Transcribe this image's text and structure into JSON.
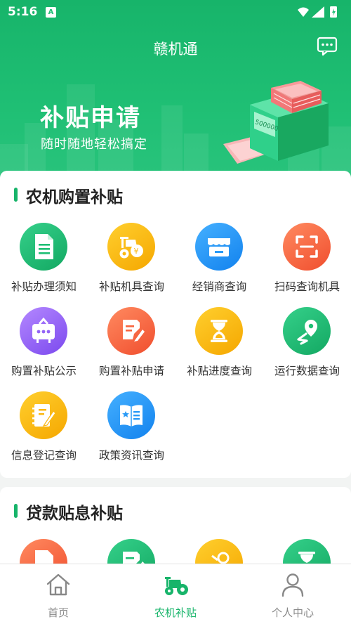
{
  "status_bar": {
    "time": "5:16",
    "indicator": "A"
  },
  "header": {
    "title": "赣机通",
    "message_icon": "chat-bubble-icon"
  },
  "banner": {
    "title": "补贴申请",
    "subtitle": "随时随地轻松搞定",
    "machine_display": "500000"
  },
  "section1": {
    "title": "农机购置补贴",
    "items": [
      {
        "label": "补贴办理须知",
        "icon": "document-icon",
        "color": "#1fbf74"
      },
      {
        "label": "补贴机具查询",
        "icon": "tractor-icon",
        "color": "#fbb814"
      },
      {
        "label": "经销商查询",
        "icon": "store-icon",
        "color": "#2b9bf7"
      },
      {
        "label": "扫码查询机具",
        "icon": "scan-icon",
        "color": "#f8663f"
      },
      {
        "label": "购置补贴公示",
        "icon": "notice-board-icon",
        "color": "#9465f6"
      },
      {
        "label": "购置补贴申请",
        "icon": "edit-form-icon",
        "color": "#f8663f"
      },
      {
        "label": "补贴进度查询",
        "icon": "hourglass-icon",
        "color": "#fbb814"
      },
      {
        "label": "运行数据查询",
        "icon": "location-route-icon",
        "color": "#1fbf74"
      },
      {
        "label": "信息登记查询",
        "icon": "notebook-pen-icon",
        "color": "#fbb814"
      },
      {
        "label": "政策资讯查询",
        "icon": "policy-book-icon",
        "color": "#2b9bf7"
      }
    ]
  },
  "section2": {
    "title": "贷款贴息补贴"
  },
  "tabbar": {
    "tabs": [
      {
        "label": "首页",
        "icon": "home-icon",
        "active": false
      },
      {
        "label": "农机补贴",
        "icon": "tractor-icon",
        "active": true
      },
      {
        "label": "个人中心",
        "icon": "person-icon",
        "active": false
      }
    ]
  }
}
